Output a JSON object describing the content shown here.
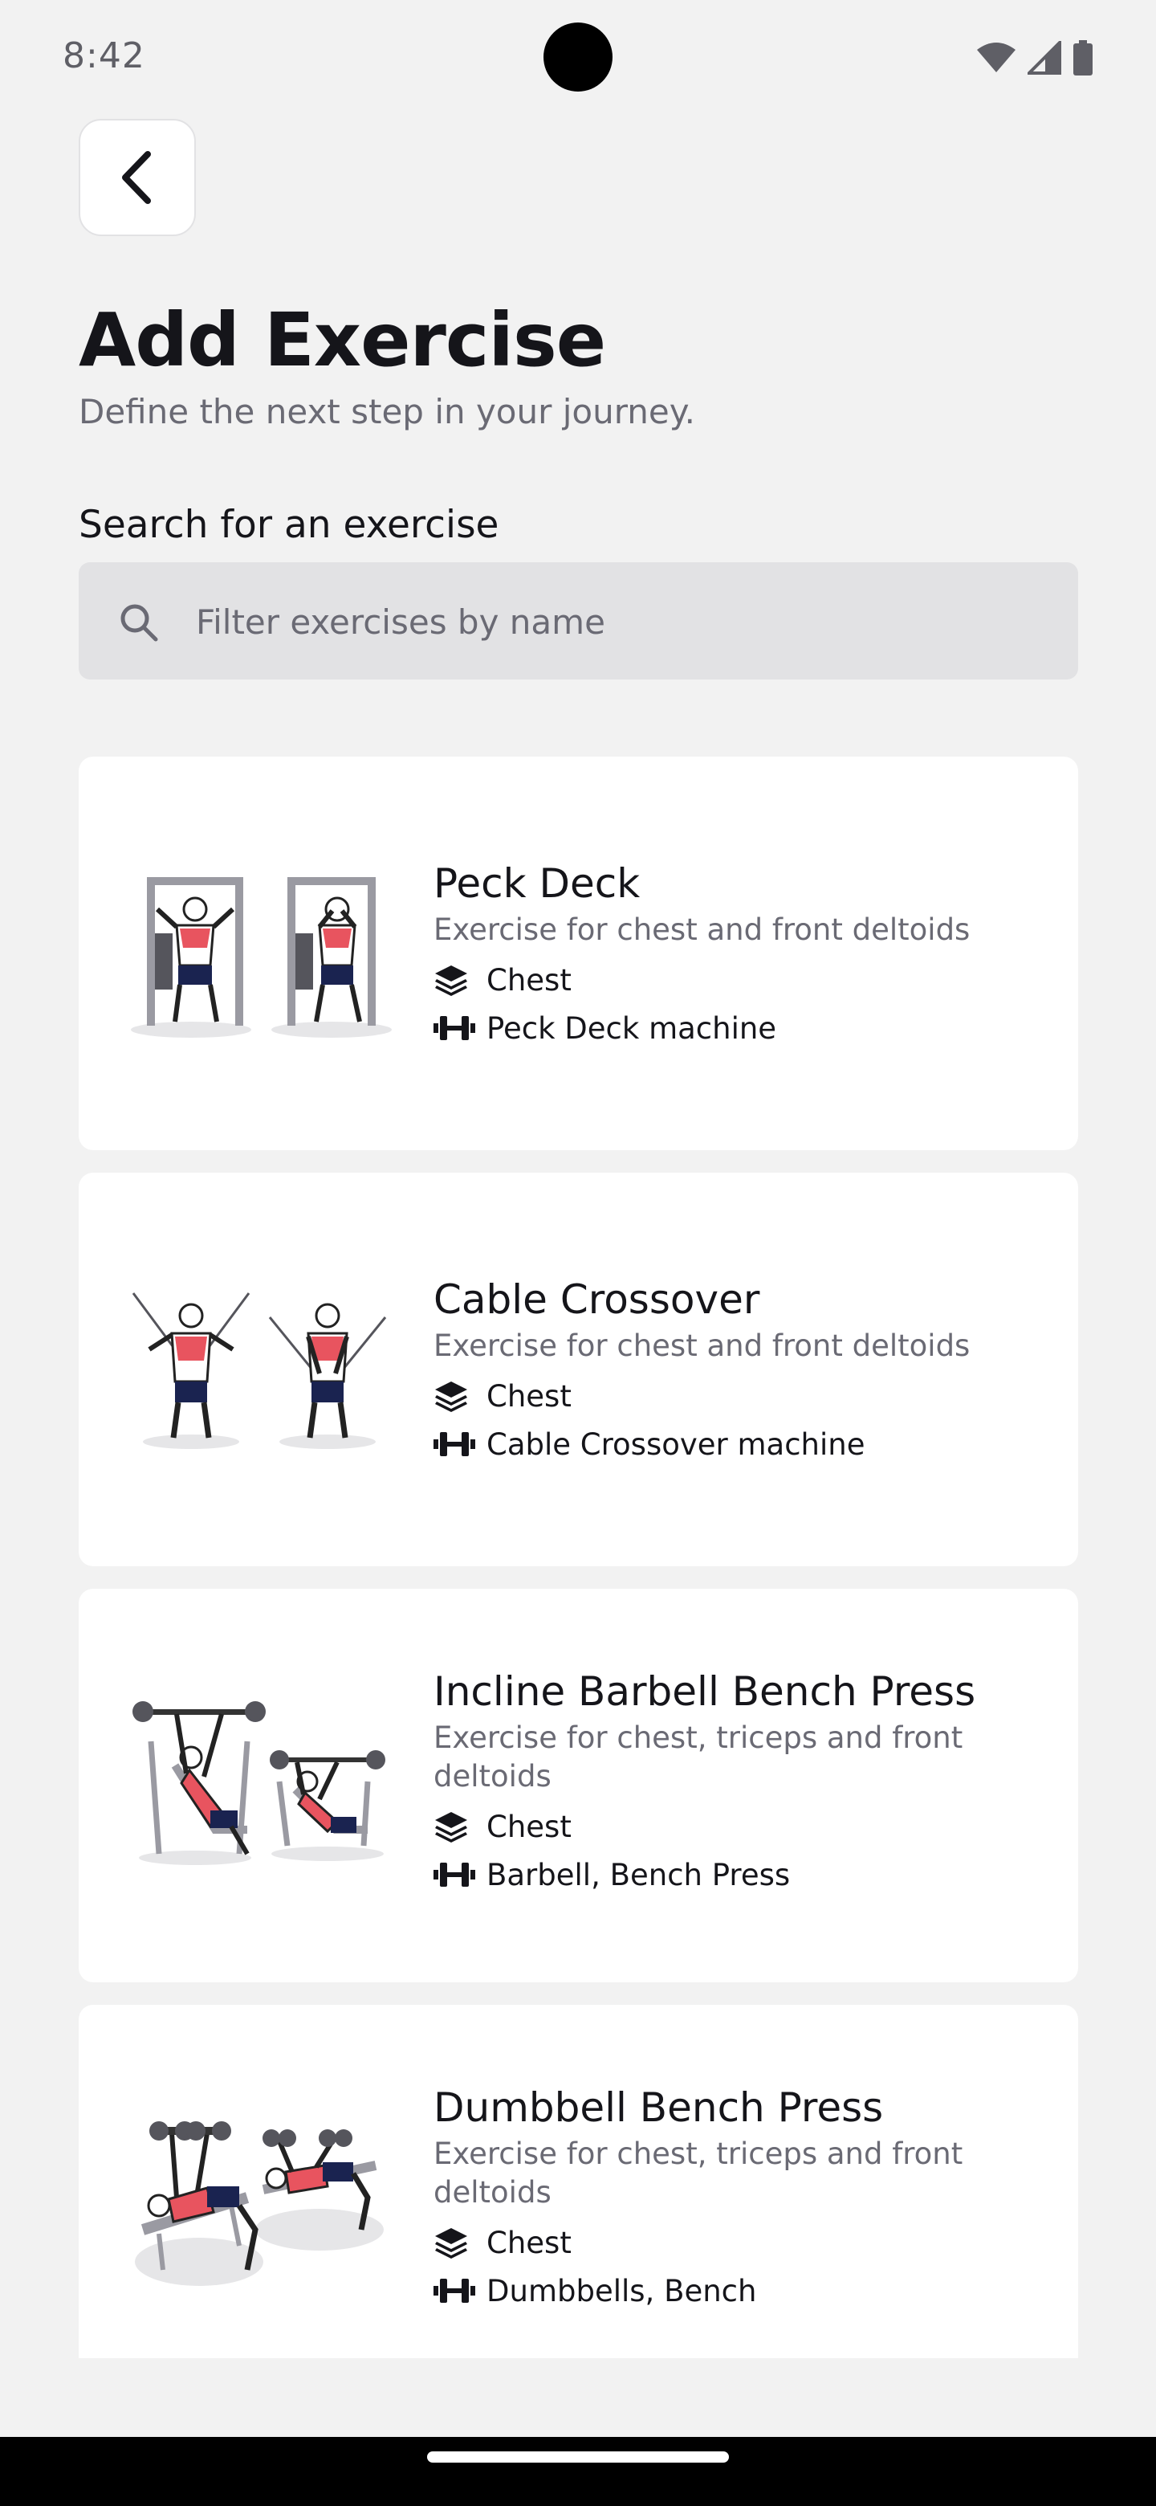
{
  "status_bar": {
    "time": "8:42"
  },
  "header": {
    "title": "Add Exercise",
    "subtitle": "Define the next step in your journey."
  },
  "search": {
    "label": "Search for an exercise",
    "placeholder": "Filter exercises by name",
    "value": ""
  },
  "exercises": [
    {
      "name": "Peck Deck",
      "description": "Exercise for chest and front deltoids",
      "muscle": "Chest",
      "equipment": "Peck Deck machine",
      "thumbnail_icon": "peck-deck-illustration"
    },
    {
      "name": "Cable Crossover",
      "description": "Exercise for chest and front deltoids",
      "muscle": "Chest",
      "equipment": "Cable Crossover machine",
      "thumbnail_icon": "cable-crossover-illustration"
    },
    {
      "name": "Incline Barbell Bench Press",
      "description": "Exercise for chest, triceps and front deltoids",
      "muscle": "Chest",
      "equipment": "Barbell, Bench Press",
      "thumbnail_icon": "incline-bench-press-illustration"
    },
    {
      "name": "Dumbbell Bench Press",
      "description": "Exercise for chest, triceps and front deltoids",
      "muscle": "Chest",
      "equipment": "Dumbbells, Bench",
      "thumbnail_icon": "dumbbell-bench-press-illustration"
    }
  ],
  "colors": {
    "background": "#f2f2f2",
    "card": "#ffffff",
    "text_primary": "#15151a",
    "text_secondary": "#6a6a74",
    "muscle_highlight": "#e8545f",
    "shorts": "#1a2350",
    "search_bg": "#e2e2e4"
  }
}
